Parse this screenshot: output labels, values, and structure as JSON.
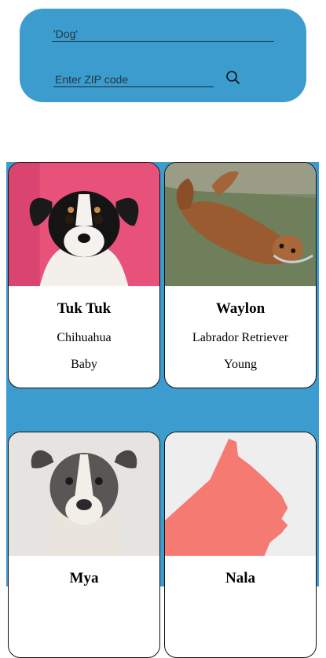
{
  "search": {
    "animal_type_value": "'Dog'",
    "zip_placeholder": "Enter ZIP code"
  },
  "pets": [
    {
      "name": "Tuk Tuk",
      "breed": "Chihuahua",
      "age": "Baby"
    },
    {
      "name": "Waylon",
      "breed": "Labrador Retriever",
      "age": "Young"
    },
    {
      "name": "Mya",
      "breed": "",
      "age": ""
    },
    {
      "name": "Nala",
      "breed": "",
      "age": ""
    }
  ],
  "colors": {
    "panel": "#3b9ccd",
    "placeholder_silhouette": "#f57a72"
  }
}
